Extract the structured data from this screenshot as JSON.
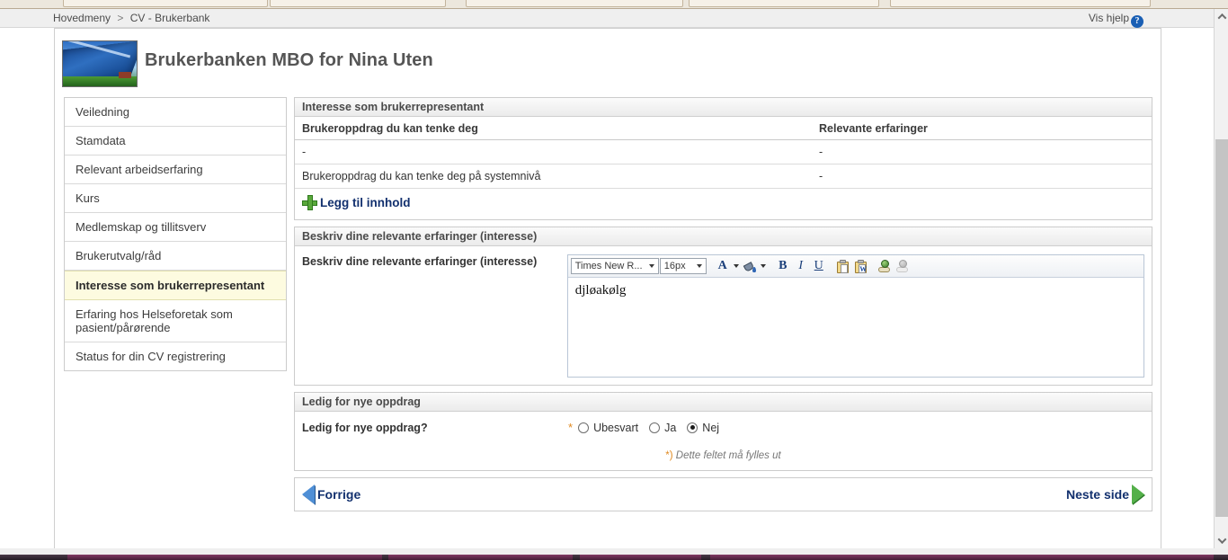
{
  "browser": {
    "menu_tabs": [
      "",
      "",
      "",
      "",
      ""
    ]
  },
  "breadcrumb": {
    "items": [
      "Hovedmeny",
      "CV - Brukerbank"
    ],
    "separator": ">"
  },
  "help": {
    "label": "Vis hjelp",
    "icon": "help-question-icon",
    "icon_glyph": "?",
    "accent": "#1a5fb4"
  },
  "header": {
    "title": "Brukerbanken MBO for Nina Uten",
    "thumbnail_name": "header-photo-thumbnail"
  },
  "sidebar": {
    "items": [
      {
        "label": "Veiledning",
        "active": false
      },
      {
        "label": "Stamdata",
        "active": false
      },
      {
        "label": "Relevant arbeidserfaring",
        "active": false
      },
      {
        "label": "Kurs",
        "active": false
      },
      {
        "label": "Medlemskap og tillitsverv",
        "active": false
      },
      {
        "label": "Brukerutvalg/råd",
        "active": false
      },
      {
        "label": "Interesse som brukerrepresentant",
        "active": true
      },
      {
        "label": "Erfaring hos Helseforetak som pasient/pårørende",
        "active": false
      },
      {
        "label": "Status for din CV registrering",
        "active": false
      }
    ],
    "active_bg": "#fdfbe0"
  },
  "panel_interest": {
    "title": "Interesse som brukerrepresentant",
    "columns": [
      "Brukeroppdrag du kan tenke deg",
      "Relevante erfaringer"
    ],
    "rows": [
      [
        "-",
        "-"
      ],
      [
        "Brukeroppdrag du kan tenke deg på systemnivå",
        "-"
      ]
    ],
    "add_link": "Legg til innhold",
    "add_icon": "plus-icon"
  },
  "panel_experience": {
    "title": "Beskriv dine relevante erfaringer (interesse)",
    "field_label": "Beskriv dine relevante erfaringer (interesse)",
    "editor": {
      "font_family_value": "Times New R...",
      "font_size_value": "16px",
      "content": "djløakølg",
      "buttons": [
        {
          "name": "text-color-icon",
          "glyph": "A",
          "has_dropdown": true
        },
        {
          "name": "background-color-icon",
          "glyph": "bucket",
          "has_dropdown": true
        },
        {
          "name": "bold-icon",
          "glyph": "B",
          "has_dropdown": false
        },
        {
          "name": "italic-icon",
          "glyph": "I",
          "has_dropdown": false
        },
        {
          "name": "underline-icon",
          "glyph": "U",
          "has_dropdown": false
        },
        {
          "name": "paste-icon",
          "glyph": "clipboard",
          "has_dropdown": false
        },
        {
          "name": "paste-from-word-icon",
          "glyph": "clipboard-w",
          "has_dropdown": false
        },
        {
          "name": "insert-link-icon",
          "glyph": "globe-link",
          "has_dropdown": false
        },
        {
          "name": "remove-link-icon",
          "glyph": "globe-link-disabled",
          "has_dropdown": false
        }
      ]
    }
  },
  "panel_available": {
    "title": "Ledig for nye oppdrag",
    "field_label": "Ledig for nye oppdrag?",
    "required_marker": "*",
    "options": [
      {
        "label": "Ubesvart",
        "selected": false
      },
      {
        "label": "Ja",
        "selected": false
      },
      {
        "label": "Nej",
        "selected": true
      }
    ],
    "hint_star": "*)",
    "hint_text": " Dette feltet må fylles ut"
  },
  "pager": {
    "prev_label": "Forrige",
    "next_label": "Neste side",
    "prev_icon": "triangle-left-icon",
    "next_icon": "triangle-right-icon",
    "prev_color": "#4f8fd6",
    "next_color": "#54b04a"
  },
  "scrollbar": {
    "up_icon": "chevron-up-icon",
    "down_icon": "chevron-down-icon"
  }
}
